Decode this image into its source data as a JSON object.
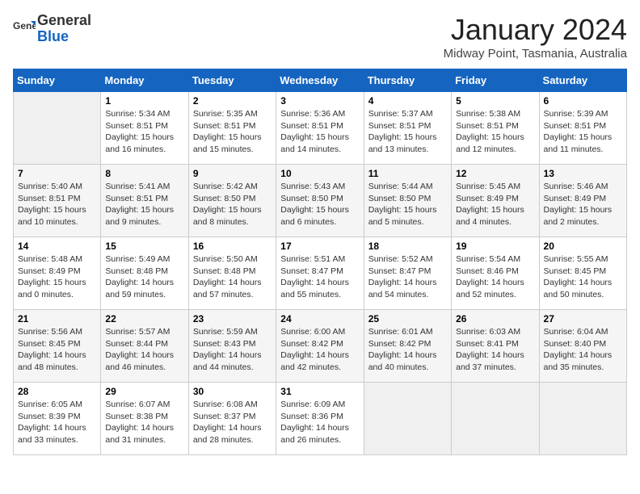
{
  "header": {
    "logo_general": "General",
    "logo_blue": "Blue",
    "month": "January 2024",
    "location": "Midway Point, Tasmania, Australia"
  },
  "weekdays": [
    "Sunday",
    "Monday",
    "Tuesday",
    "Wednesday",
    "Thursday",
    "Friday",
    "Saturday"
  ],
  "weeks": [
    [
      {
        "day": "",
        "info": ""
      },
      {
        "day": "1",
        "info": "Sunrise: 5:34 AM\nSunset: 8:51 PM\nDaylight: 15 hours\nand 16 minutes."
      },
      {
        "day": "2",
        "info": "Sunrise: 5:35 AM\nSunset: 8:51 PM\nDaylight: 15 hours\nand 15 minutes."
      },
      {
        "day": "3",
        "info": "Sunrise: 5:36 AM\nSunset: 8:51 PM\nDaylight: 15 hours\nand 14 minutes."
      },
      {
        "day": "4",
        "info": "Sunrise: 5:37 AM\nSunset: 8:51 PM\nDaylight: 15 hours\nand 13 minutes."
      },
      {
        "day": "5",
        "info": "Sunrise: 5:38 AM\nSunset: 8:51 PM\nDaylight: 15 hours\nand 12 minutes."
      },
      {
        "day": "6",
        "info": "Sunrise: 5:39 AM\nSunset: 8:51 PM\nDaylight: 15 hours\nand 11 minutes."
      }
    ],
    [
      {
        "day": "7",
        "info": "Sunrise: 5:40 AM\nSunset: 8:51 PM\nDaylight: 15 hours\nand 10 minutes."
      },
      {
        "day": "8",
        "info": "Sunrise: 5:41 AM\nSunset: 8:51 PM\nDaylight: 15 hours\nand 9 minutes."
      },
      {
        "day": "9",
        "info": "Sunrise: 5:42 AM\nSunset: 8:50 PM\nDaylight: 15 hours\nand 8 minutes."
      },
      {
        "day": "10",
        "info": "Sunrise: 5:43 AM\nSunset: 8:50 PM\nDaylight: 15 hours\nand 6 minutes."
      },
      {
        "day": "11",
        "info": "Sunrise: 5:44 AM\nSunset: 8:50 PM\nDaylight: 15 hours\nand 5 minutes."
      },
      {
        "day": "12",
        "info": "Sunrise: 5:45 AM\nSunset: 8:49 PM\nDaylight: 15 hours\nand 4 minutes."
      },
      {
        "day": "13",
        "info": "Sunrise: 5:46 AM\nSunset: 8:49 PM\nDaylight: 15 hours\nand 2 minutes."
      }
    ],
    [
      {
        "day": "14",
        "info": "Sunrise: 5:48 AM\nSunset: 8:49 PM\nDaylight: 15 hours\nand 0 minutes."
      },
      {
        "day": "15",
        "info": "Sunrise: 5:49 AM\nSunset: 8:48 PM\nDaylight: 14 hours\nand 59 minutes."
      },
      {
        "day": "16",
        "info": "Sunrise: 5:50 AM\nSunset: 8:48 PM\nDaylight: 14 hours\nand 57 minutes."
      },
      {
        "day": "17",
        "info": "Sunrise: 5:51 AM\nSunset: 8:47 PM\nDaylight: 14 hours\nand 55 minutes."
      },
      {
        "day": "18",
        "info": "Sunrise: 5:52 AM\nSunset: 8:47 PM\nDaylight: 14 hours\nand 54 minutes."
      },
      {
        "day": "19",
        "info": "Sunrise: 5:54 AM\nSunset: 8:46 PM\nDaylight: 14 hours\nand 52 minutes."
      },
      {
        "day": "20",
        "info": "Sunrise: 5:55 AM\nSunset: 8:45 PM\nDaylight: 14 hours\nand 50 minutes."
      }
    ],
    [
      {
        "day": "21",
        "info": "Sunrise: 5:56 AM\nSunset: 8:45 PM\nDaylight: 14 hours\nand 48 minutes."
      },
      {
        "day": "22",
        "info": "Sunrise: 5:57 AM\nSunset: 8:44 PM\nDaylight: 14 hours\nand 46 minutes."
      },
      {
        "day": "23",
        "info": "Sunrise: 5:59 AM\nSunset: 8:43 PM\nDaylight: 14 hours\nand 44 minutes."
      },
      {
        "day": "24",
        "info": "Sunrise: 6:00 AM\nSunset: 8:42 PM\nDaylight: 14 hours\nand 42 minutes."
      },
      {
        "day": "25",
        "info": "Sunrise: 6:01 AM\nSunset: 8:42 PM\nDaylight: 14 hours\nand 40 minutes."
      },
      {
        "day": "26",
        "info": "Sunrise: 6:03 AM\nSunset: 8:41 PM\nDaylight: 14 hours\nand 37 minutes."
      },
      {
        "day": "27",
        "info": "Sunrise: 6:04 AM\nSunset: 8:40 PM\nDaylight: 14 hours\nand 35 minutes."
      }
    ],
    [
      {
        "day": "28",
        "info": "Sunrise: 6:05 AM\nSunset: 8:39 PM\nDaylight: 14 hours\nand 33 minutes."
      },
      {
        "day": "29",
        "info": "Sunrise: 6:07 AM\nSunset: 8:38 PM\nDaylight: 14 hours\nand 31 minutes."
      },
      {
        "day": "30",
        "info": "Sunrise: 6:08 AM\nSunset: 8:37 PM\nDaylight: 14 hours\nand 28 minutes."
      },
      {
        "day": "31",
        "info": "Sunrise: 6:09 AM\nSunset: 8:36 PM\nDaylight: 14 hours\nand 26 minutes."
      },
      {
        "day": "",
        "info": ""
      },
      {
        "day": "",
        "info": ""
      },
      {
        "day": "",
        "info": ""
      }
    ]
  ]
}
